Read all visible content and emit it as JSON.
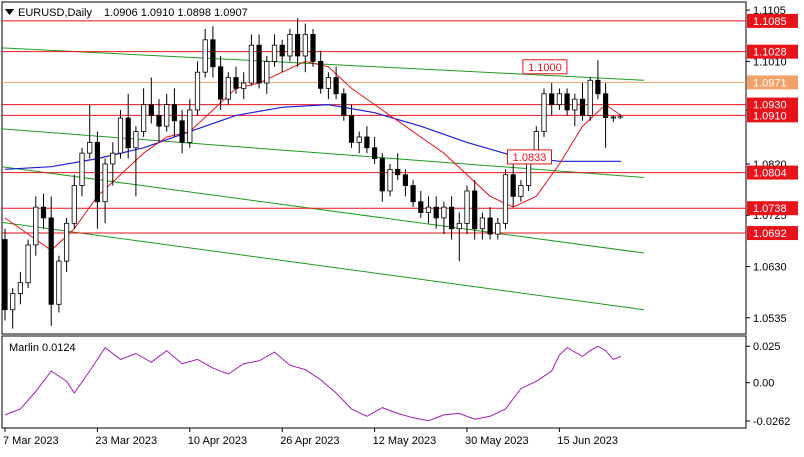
{
  "chart_data": [
    {
      "type": "candlestick",
      "symbol": "EURUSD,Daily",
      "ohlc_header": "1.0906 1.0910 1.0898 1.0907",
      "ylim": [
        1.0505,
        1.112
      ],
      "y_ticks": [
        "1.1105",
        "1.1010",
        "1.0920",
        "1.0820",
        "1.0725",
        "1.0630",
        "1.0535"
      ],
      "x_ticks": [
        {
          "label": "7 Mar 2023",
          "index": 0
        },
        {
          "label": "23 Mar 2023",
          "index": 12
        },
        {
          "label": "10 Apr 2023",
          "index": 24
        },
        {
          "label": "26 Apr 2023",
          "index": 36
        },
        {
          "label": "12 May 2023",
          "index": 48
        },
        {
          "label": "30 May 2023",
          "index": 60
        },
        {
          "label": "15 Jun 2023",
          "index": 72
        }
      ],
      "colors": {
        "background": "#ffffff",
        "bull": "#ffffff",
        "bear": "#000000",
        "ma_fast": "#e8121b",
        "ma_slow": "#1f1fd6",
        "channel": "#1f9b1f",
        "level": "#e8121b",
        "level_orange": "#f2a268",
        "label_bg": "#e8121b",
        "label_text": "#ffffff"
      },
      "candles": [
        [
          1.068,
          1.07,
          1.053,
          1.055
        ],
        [
          1.055,
          1.059,
          1.0515,
          1.058
        ],
        [
          1.058,
          1.062,
          1.056,
          1.06
        ],
        [
          1.06,
          1.068,
          1.059,
          1.067
        ],
        [
          1.067,
          1.076,
          1.065,
          1.074
        ],
        [
          1.074,
          1.0765,
          1.07,
          1.072
        ],
        [
          1.072,
          1.076,
          1.052,
          1.056
        ],
        [
          1.056,
          1.065,
          1.0545,
          1.064
        ],
        [
          1.064,
          1.072,
          1.062,
          1.071
        ],
        [
          1.071,
          1.08,
          1.07,
          1.078
        ],
        [
          1.078,
          1.085,
          1.076,
          1.084
        ],
        [
          1.084,
          1.093,
          1.083,
          1.086
        ],
        [
          1.086,
          1.088,
          1.07,
          1.075
        ],
        [
          1.075,
          1.083,
          1.071,
          1.082
        ],
        [
          1.082,
          1.086,
          1.078,
          1.084
        ],
        [
          1.084,
          1.092,
          1.083,
          1.0905
        ],
        [
          1.0905,
          1.095,
          1.083,
          1.085
        ],
        [
          1.085,
          1.089,
          1.076,
          1.088
        ],
        [
          1.088,
          1.096,
          1.087,
          1.093
        ],
        [
          1.093,
          1.098,
          1.0895,
          1.091
        ],
        [
          1.091,
          1.094,
          1.086,
          1.089
        ],
        [
          1.089,
          1.095,
          1.088,
          1.093
        ],
        [
          1.093,
          1.096,
          1.087,
          1.09
        ],
        [
          1.09,
          1.092,
          1.084,
          1.086
        ],
        [
          1.086,
          1.094,
          1.085,
          1.092
        ],
        [
          1.092,
          1.101,
          1.091,
          1.099
        ],
        [
          1.099,
          1.107,
          1.098,
          1.105
        ],
        [
          1.105,
          1.1075,
          1.098,
          1.1
        ],
        [
          1.1,
          1.102,
          1.092,
          1.094
        ],
        [
          1.094,
          1.099,
          1.093,
          1.098
        ],
        [
          1.098,
          1.1,
          1.095,
          1.096
        ],
        [
          1.096,
          1.099,
          1.094,
          1.097
        ],
        [
          1.097,
          1.106,
          1.0965,
          1.104
        ],
        [
          1.104,
          1.106,
          1.096,
          1.097
        ],
        [
          1.097,
          1.102,
          1.095,
          1.101
        ],
        [
          1.101,
          1.106,
          1.1,
          1.104
        ],
        [
          1.104,
          1.105,
          1.099,
          1.102
        ],
        [
          1.102,
          1.107,
          1.101,
          1.106
        ],
        [
          1.106,
          1.109,
          1.1,
          1.102
        ],
        [
          1.102,
          1.108,
          1.099,
          1.106
        ],
        [
          1.106,
          1.107,
          1.1,
          1.101
        ],
        [
          1.101,
          1.103,
          1.095,
          1.096
        ],
        [
          1.096,
          1.099,
          1.094,
          1.098
        ],
        [
          1.098,
          1.1,
          1.094,
          1.095
        ],
        [
          1.095,
          1.096,
          1.09,
          1.091
        ],
        [
          1.091,
          1.093,
          1.085,
          1.086
        ],
        [
          1.086,
          1.088,
          1.084,
          1.087
        ],
        [
          1.087,
          1.089,
          1.084,
          1.085
        ],
        [
          1.085,
          1.087,
          1.082,
          1.083
        ],
        [
          1.083,
          1.084,
          1.075,
          1.077
        ],
        [
          1.077,
          1.082,
          1.076,
          1.081
        ],
        [
          1.081,
          1.084,
          1.079,
          1.08
        ],
        [
          1.08,
          1.081,
          1.076,
          1.078
        ],
        [
          1.078,
          1.079,
          1.074,
          1.075
        ],
        [
          1.075,
          1.077,
          1.072,
          1.073
        ],
        [
          1.073,
          1.076,
          1.071,
          1.074
        ],
        [
          1.074,
          1.076,
          1.07,
          1.072
        ],
        [
          1.072,
          1.075,
          1.069,
          1.074
        ],
        [
          1.074,
          1.076,
          1.068,
          1.07
        ],
        [
          1.07,
          1.073,
          1.064,
          1.071
        ],
        [
          1.071,
          1.078,
          1.069,
          1.077
        ],
        [
          1.077,
          1.079,
          1.068,
          1.07
        ],
        [
          1.07,
          1.073,
          1.068,
          1.072
        ],
        [
          1.072,
          1.074,
          1.068,
          1.069
        ],
        [
          1.069,
          1.072,
          1.068,
          1.071
        ],
        [
          1.071,
          1.081,
          1.07,
          1.08
        ],
        [
          1.08,
          1.082,
          1.074,
          1.076
        ],
        [
          1.076,
          1.079,
          1.075,
          1.078
        ],
        [
          1.078,
          1.084,
          1.077,
          1.083
        ],
        [
          1.083,
          1.089,
          1.082,
          1.088
        ],
        [
          1.088,
          1.096,
          1.087,
          1.095
        ],
        [
          1.095,
          1.097,
          1.091,
          1.093
        ],
        [
          1.093,
          1.096,
          1.092,
          1.095
        ],
        [
          1.095,
          1.096,
          1.091,
          1.092
        ],
        [
          1.092,
          1.095,
          1.089,
          1.094
        ],
        [
          1.094,
          1.097,
          1.09,
          1.091
        ],
        [
          1.091,
          1.098,
          1.09,
          1.0975
        ],
        [
          1.0975,
          1.1012,
          1.094,
          1.095
        ],
        [
          1.095,
          1.097,
          1.085,
          1.0906
        ],
        [
          1.0906,
          1.091,
          1.0898,
          1.0907
        ]
      ],
      "ma_fast": [
        [
          0,
          1.072
        ],
        [
          3,
          1.069
        ],
        [
          6,
          1.066
        ],
        [
          9,
          1.07
        ],
        [
          12,
          1.076
        ],
        [
          15,
          1.08
        ],
        [
          18,
          1.084
        ],
        [
          21,
          1.087
        ],
        [
          24,
          1.088
        ],
        [
          27,
          1.092
        ],
        [
          30,
          1.096
        ],
        [
          33,
          1.097
        ],
        [
          36,
          1.099
        ],
        [
          39,
          1.101
        ],
        [
          42,
          1.1
        ],
        [
          45,
          1.096
        ],
        [
          48,
          1.093
        ],
        [
          51,
          1.09
        ],
        [
          54,
          1.087
        ],
        [
          57,
          1.084
        ],
        [
          60,
          1.08
        ],
        [
          63,
          1.076
        ],
        [
          66,
          1.074
        ],
        [
          69,
          1.076
        ],
        [
          72,
          1.082
        ],
        [
          75,
          1.089
        ],
        [
          78,
          1.093
        ],
        [
          80,
          1.091
        ]
      ],
      "ma_slow": [
        [
          0,
          1.081
        ],
        [
          6,
          1.0815
        ],
        [
          12,
          1.083
        ],
        [
          18,
          1.085
        ],
        [
          24,
          1.088
        ],
        [
          30,
          1.091
        ],
        [
          36,
          1.0925
        ],
        [
          42,
          1.093
        ],
        [
          48,
          1.0915
        ],
        [
          54,
          1.089
        ],
        [
          60,
          1.086
        ],
        [
          66,
          1.0835
        ],
        [
          72,
          1.0825
        ],
        [
          80,
          1.0825
        ]
      ],
      "channel_lines": [
        {
          "x1": -0.5,
          "y1": 1.1035,
          "x2": 83,
          "y2": 1.0975
        },
        {
          "x1": -0.5,
          "y1": 1.0885,
          "x2": 83,
          "y2": 1.0795
        },
        {
          "x1": -0.5,
          "y1": 1.0815,
          "x2": 83,
          "y2": 1.0655
        },
        {
          "x1": -0.5,
          "y1": 1.0712,
          "x2": 83,
          "y2": 1.055
        }
      ],
      "levels": [
        {
          "price": 1.1085,
          "label": "1.1085",
          "color": "level"
        },
        {
          "price": 1.1028,
          "label": "1.1028",
          "color": "level"
        },
        {
          "price": 1.0971,
          "label": "1.0971",
          "color": "level_orange"
        },
        {
          "price": 1.093,
          "label": "1.0930",
          "color": "level"
        },
        {
          "price": 1.091,
          "label": "1.0910",
          "color": "level"
        },
        {
          "price": 1.0804,
          "label": "1.0804",
          "color": "level"
        },
        {
          "price": 1.0738,
          "label": "1.0738",
          "color": "level"
        },
        {
          "price": 1.0692,
          "label": "1.0692",
          "color": "level"
        }
      ],
      "callouts": [
        {
          "label": "1.1000",
          "index": 67,
          "price": 1.1
        },
        {
          "label": "1.0833",
          "index": 65,
          "price": 1.0833
        }
      ],
      "last_price_marker": 1.0907
    },
    {
      "type": "line",
      "title": "Marlin 0.0124",
      "ylim": [
        -0.031,
        0.032
      ],
      "y_ticks": [
        "0.025",
        "0.00",
        "-0.0262"
      ],
      "color": "#a01fb0",
      "values": [
        [
          0,
          -0.022
        ],
        [
          2,
          -0.018
        ],
        [
          4,
          -0.006
        ],
        [
          6,
          0.008
        ],
        [
          8,
          0.001
        ],
        [
          9,
          -0.007
        ],
        [
          11,
          0.008
        ],
        [
          13,
          0.024
        ],
        [
          15,
          0.016
        ],
        [
          17,
          0.02
        ],
        [
          19,
          0.014
        ],
        [
          21,
          0.022
        ],
        [
          23,
          0.013
        ],
        [
          25,
          0.016
        ],
        [
          27,
          0.01
        ],
        [
          29,
          0.006
        ],
        [
          31,
          0.013
        ],
        [
          33,
          0.015
        ],
        [
          35,
          0.021
        ],
        [
          37,
          0.012
        ],
        [
          39,
          0.009
        ],
        [
          41,
          0.002
        ],
        [
          43,
          -0.007
        ],
        [
          45,
          -0.018
        ],
        [
          47,
          -0.023
        ],
        [
          49,
          -0.017
        ],
        [
          51,
          -0.021
        ],
        [
          53,
          -0.024
        ],
        [
          55,
          -0.026
        ],
        [
          57,
          -0.022
        ],
        [
          59,
          -0.021
        ],
        [
          61,
          -0.025
        ],
        [
          63,
          -0.023
        ],
        [
          65,
          -0.018
        ],
        [
          67,
          -0.004
        ],
        [
          69,
          0.001
        ],
        [
          71,
          0.008
        ],
        [
          72,
          0.019
        ],
        [
          73,
          0.024
        ],
        [
          74,
          0.021
        ],
        [
          75,
          0.018
        ],
        [
          76,
          0.022
        ],
        [
          77,
          0.025
        ],
        [
          78,
          0.022
        ],
        [
          79,
          0.016
        ],
        [
          80,
          0.018
        ]
      ]
    }
  ]
}
